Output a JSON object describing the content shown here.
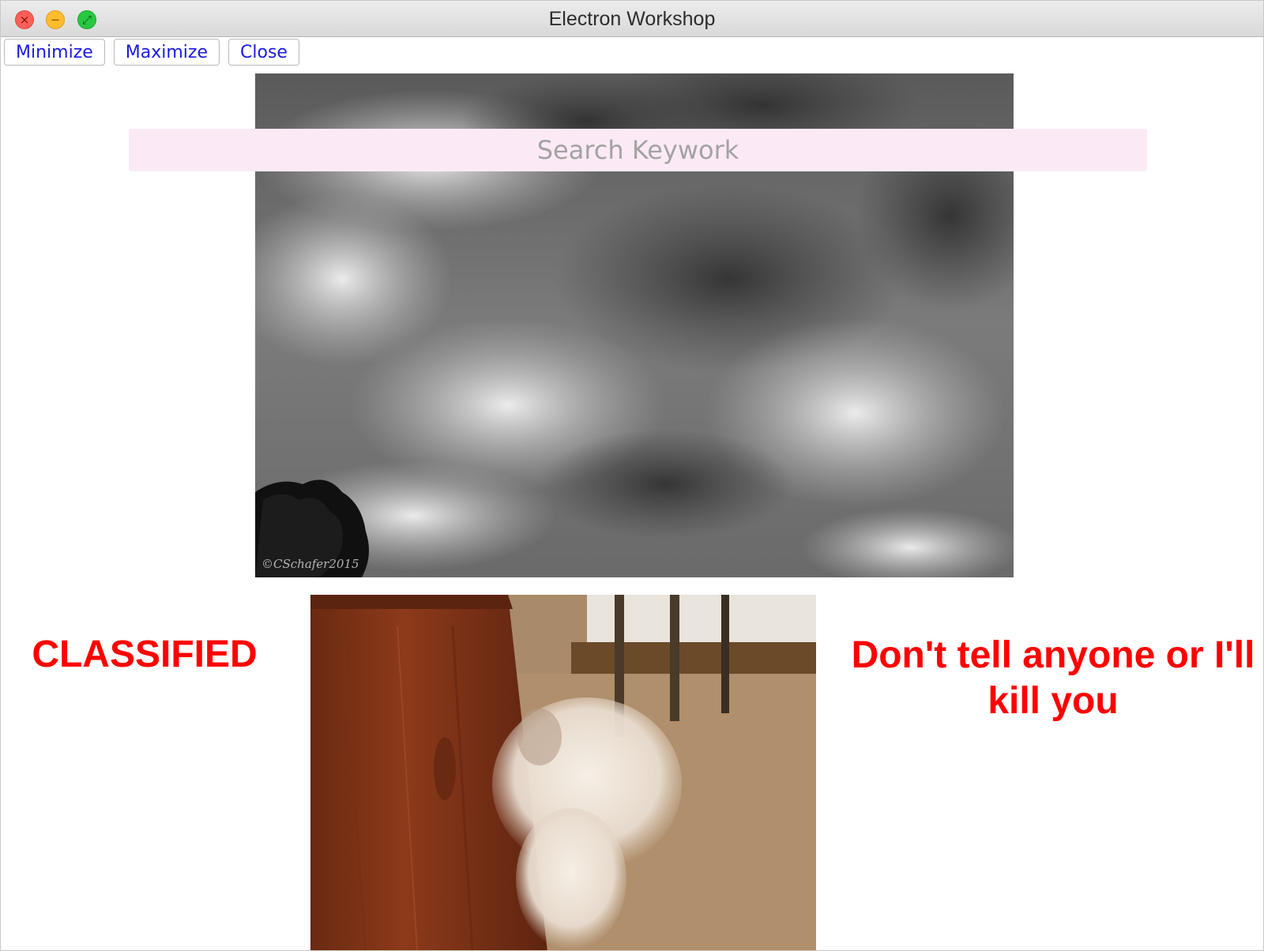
{
  "window": {
    "title": "Electron Workshop"
  },
  "toolbar": {
    "minimize_label": "Minimize",
    "maximize_label": "Maximize",
    "close_label": "Close"
  },
  "search": {
    "placeholder": "Search Keywork",
    "value": ""
  },
  "gallery": {
    "storm_watermark": "©CSchafer2015"
  },
  "captions": {
    "left": "CLASSIFIED",
    "right": "Don't tell anyone or I'll kill you"
  },
  "colors": {
    "caption": "#ff0000",
    "button_text": "#1a1ae0",
    "search_background": "#fbeaf6"
  }
}
